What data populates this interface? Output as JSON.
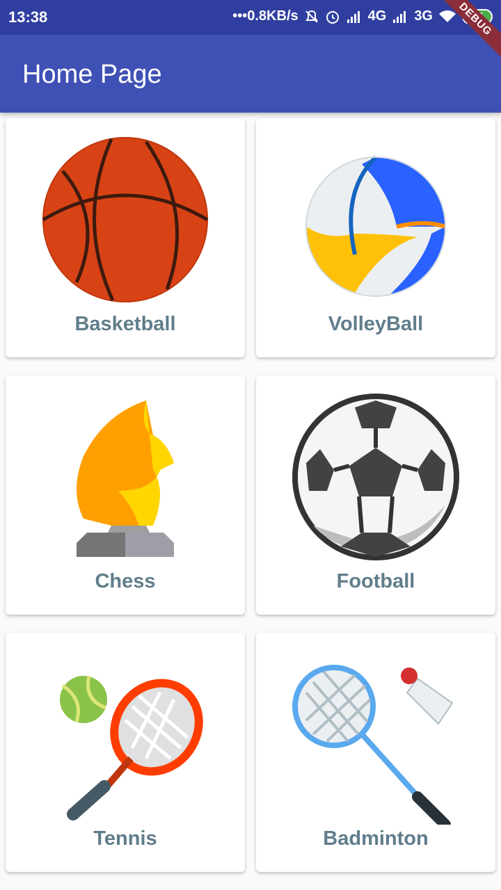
{
  "status_bar": {
    "time": "13:38",
    "net_speed": "•••0.8KB/s",
    "network_1": "4G",
    "network_2": "3G",
    "battery": "44"
  },
  "debug_banner": "DEBUG",
  "app_bar": {
    "title": "Home Page"
  },
  "sports": [
    {
      "label": "Basketball",
      "icon": "basketball-icon"
    },
    {
      "label": "VolleyBall",
      "icon": "volleyball-icon"
    },
    {
      "label": "Chess",
      "icon": "chess-knight-icon"
    },
    {
      "label": "Football",
      "icon": "football-icon"
    },
    {
      "label": "Tennis",
      "icon": "tennis-icon"
    },
    {
      "label": "Badminton",
      "icon": "badminton-icon"
    }
  ]
}
